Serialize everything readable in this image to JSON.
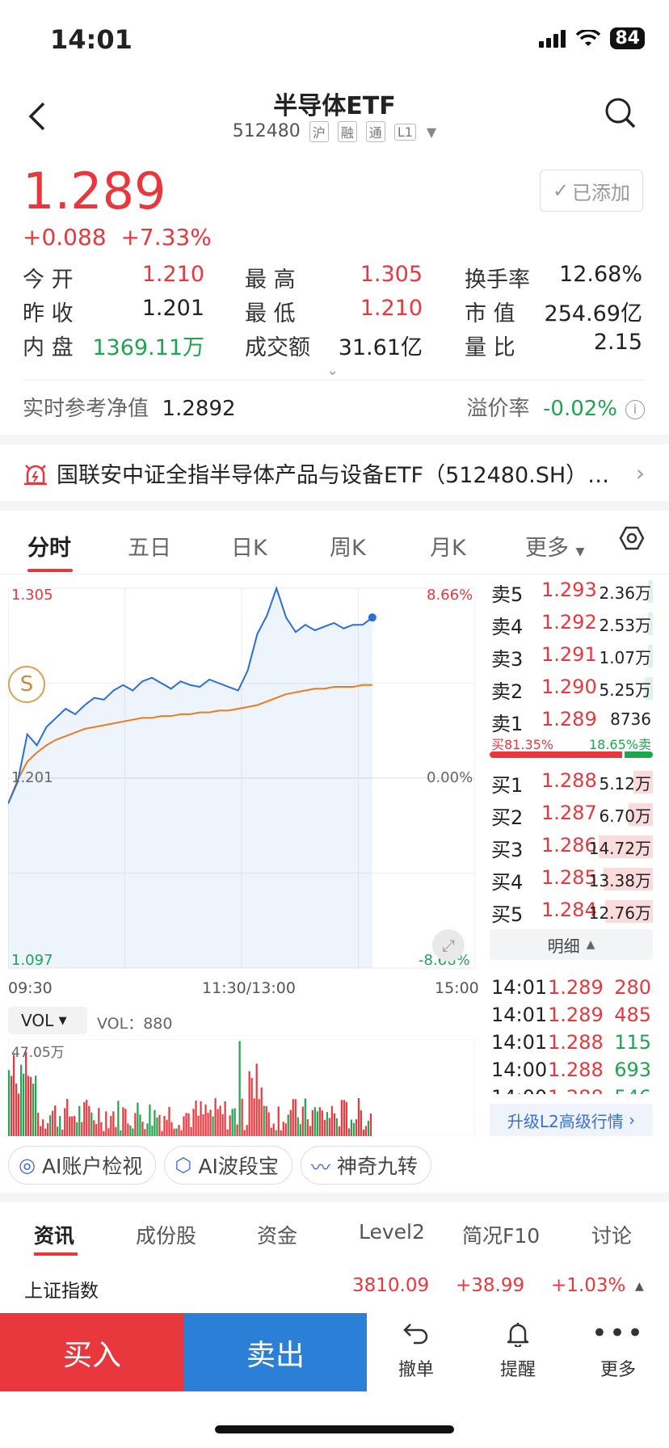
{
  "status_bar": {
    "time": "14:01",
    "battery": "84"
  },
  "header": {
    "title": "半导体ETF",
    "code": "512480",
    "tags": [
      "沪",
      "融",
      "通",
      "L1"
    ]
  },
  "quote": {
    "price": "1.289",
    "change": "+0.088",
    "change_pct": "+7.33%",
    "added_label": "已添加"
  },
  "stats": [
    [
      {
        "label": "今 开",
        "value": "1.210",
        "color": "red"
      },
      {
        "label": "最 高",
        "value": "1.305",
        "color": "red"
      },
      {
        "label": "换手率",
        "value": "12.68%",
        "color": "black"
      }
    ],
    [
      {
        "label": "昨 收",
        "value": "1.201",
        "color": "black"
      },
      {
        "label": "最 低",
        "value": "1.210",
        "color": "red"
      },
      {
        "label": "市 值",
        "value": "254.69亿",
        "color": "black"
      }
    ],
    [
      {
        "label": "内 盘",
        "value": "1369.11万",
        "color": "green"
      },
      {
        "label": "成交额",
        "value": "31.61亿",
        "color": "black"
      },
      {
        "label": "量 比",
        "value": "2.15",
        "color": "black"
      }
    ]
  ],
  "nav": {
    "label": "实时参考净值",
    "value": "1.2892",
    "premium_label": "溢价率",
    "premium_value": "-0.02%"
  },
  "notice": {
    "text": "国联安中证全指半导体产品与设备ETF（512480.SH）…"
  },
  "chart_tabs": [
    "分时",
    "五日",
    "日K",
    "周K",
    "月K",
    "更多"
  ],
  "chart": {
    "y_top": "1.305",
    "y_mid": "1.201",
    "y_bottom": "1.097",
    "pct_top": "8.66%",
    "pct_mid": "0.00%",
    "pct_bottom": "-8.66%",
    "time_start": "09:30",
    "time_mid": "11:30/13:00",
    "time_end": "15:00",
    "s_badge": "S",
    "vol_selector": "VOL",
    "vol_value": "VOL：880",
    "vol_max": "47.05万"
  },
  "chart_data": {
    "type": "line",
    "ylim": [
      1.097,
      1.305
    ],
    "series": [
      {
        "color": "#2a6fd6",
        "values": [
          1.187,
          1.199,
          1.225,
          1.219,
          1.229,
          1.234,
          1.239,
          1.236,
          1.241,
          1.245,
          1.244,
          1.249,
          1.252,
          1.249,
          1.254,
          1.256,
          1.253,
          1.25,
          1.254,
          1.252,
          1.251,
          1.255,
          1.253,
          1.251,
          1.249,
          1.26,
          1.28,
          1.29,
          1.305,
          1.289,
          1.281,
          1.285,
          1.282,
          1.284,
          1.286,
          1.283,
          1.285,
          1.285,
          1.289
        ]
      },
      {
        "color": "#ef7a1e",
        "values": [
          1.187,
          1.2,
          1.21,
          1.215,
          1.219,
          1.222,
          1.224,
          1.226,
          1.228,
          1.229,
          1.23,
          1.231,
          1.232,
          1.233,
          1.234,
          1.234,
          1.235,
          1.235,
          1.236,
          1.236,
          1.237,
          1.237,
          1.238,
          1.238,
          1.239,
          1.24,
          1.241,
          1.243,
          1.245,
          1.247,
          1.248,
          1.249,
          1.25,
          1.25,
          1.251,
          1.251,
          1.251,
          1.252,
          1.252
        ]
      }
    ],
    "volume_max": 470500
  },
  "order_book": {
    "asks": [
      {
        "label": "卖5",
        "price": "1.293",
        "vol": "2.36万",
        "bar": 0.02
      },
      {
        "label": "卖4",
        "price": "1.292",
        "vol": "2.53万",
        "bar": 0.02
      },
      {
        "label": "卖3",
        "price": "1.291",
        "vol": "1.07万",
        "bar": 0.01
      },
      {
        "label": "卖2",
        "price": "1.290",
        "vol": "5.25万",
        "bar": 0.05
      },
      {
        "label": "卖1",
        "price": "1.289",
        "vol": "8736",
        "bar": 0.0
      }
    ],
    "buy_ratio": "买81.35%",
    "sell_ratio": "18.65%卖",
    "buy_ratio_value": 0.8135,
    "bids": [
      {
        "label": "买1",
        "price": "1.288",
        "vol": "5.12万",
        "bar": 0.12
      },
      {
        "label": "买2",
        "price": "1.287",
        "vol": "6.70万",
        "bar": 0.15
      },
      {
        "label": "买3",
        "price": "1.286",
        "vol": "14.72万",
        "bar": 0.33
      },
      {
        "label": "买4",
        "price": "1.285",
        "vol": "13.38万",
        "bar": 0.3
      },
      {
        "label": "买5",
        "price": "1.284",
        "vol": "12.76万",
        "bar": 0.29
      }
    ],
    "detail_label": "明细",
    "trades": [
      {
        "time": "14:01",
        "price": "1.289",
        "qty": "280",
        "color": "red"
      },
      {
        "time": "14:01",
        "price": "1.289",
        "qty": "485",
        "color": "red"
      },
      {
        "time": "14:01",
        "price": "1.288",
        "qty": "115",
        "color": "green"
      },
      {
        "time": "14:00",
        "price": "1.288",
        "qty": "693",
        "color": "green"
      },
      {
        "time": "14:00",
        "price": "1.288",
        "qty": "546",
        "color": "green"
      }
    ],
    "upgrade_label": "升级L2高级行情"
  },
  "ai_tools": [
    "AI账户检视",
    "AI波段宝",
    "神奇九转"
  ],
  "bottom_tabs": [
    "资讯",
    "成份股",
    "资金",
    "Level2",
    "简况F10",
    "讨论"
  ],
  "index": {
    "name": "上证指数",
    "value": "3810.09",
    "change": "+38.99",
    "pct": "+1.03%"
  },
  "actions": {
    "buy": "买入",
    "sell": "卖出",
    "cancel": "撤单",
    "alert": "提醒",
    "more": "更多"
  },
  "colors": {
    "up": "#e8383d",
    "down": "#1fa54f",
    "accent": "#2a6fd6"
  }
}
